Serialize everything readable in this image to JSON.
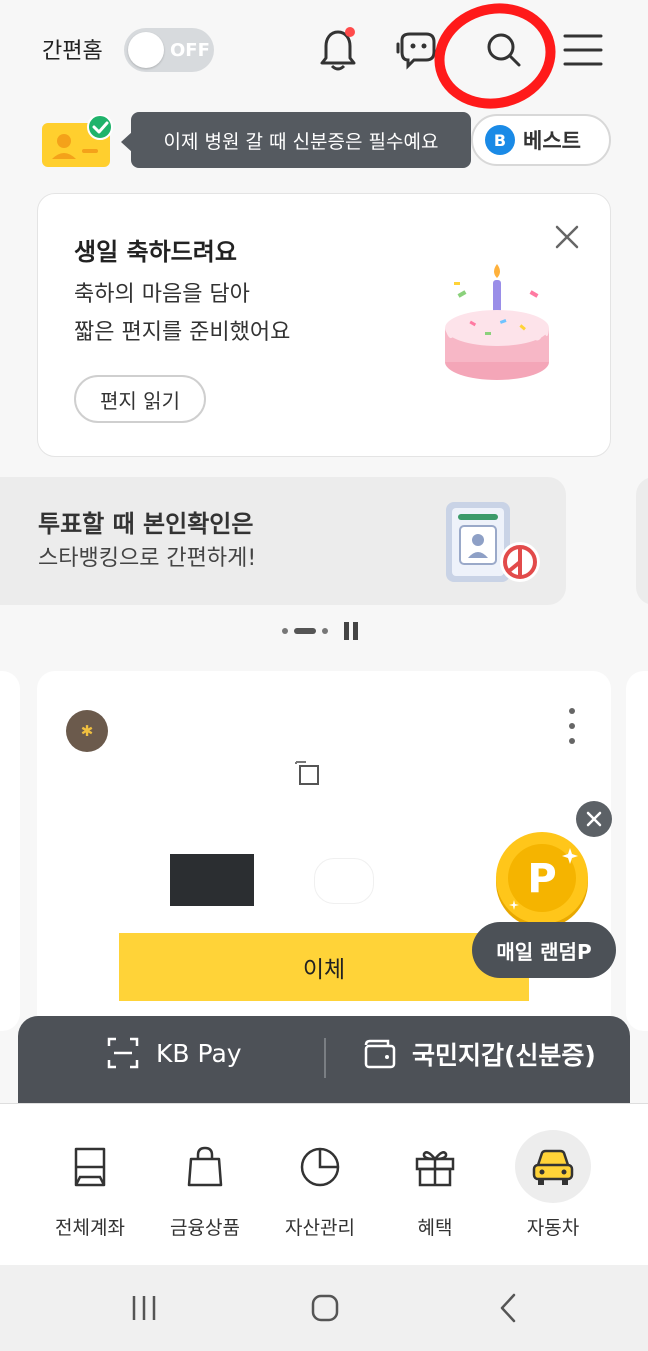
{
  "header": {
    "easy_home_label": "간편홈",
    "toggle_state": "OFF",
    "icons": [
      "bell-icon",
      "chatbot-icon",
      "search-icon",
      "menu-icon"
    ],
    "notification_dot_color": "#ff4b4b"
  },
  "notice": {
    "tooltip_text": "이제 병원 갈 때 신분증은 필수예요",
    "best_badge_letter": "B",
    "best_label": "베스트"
  },
  "birthday_card": {
    "title": "생일 축하드려요",
    "line1": "축하의 마음을 담아",
    "line2": "짧은 편지를 준비했어요",
    "button_label": "편지 읽기"
  },
  "vote_banner": {
    "title": "투표할 때 본인확인은",
    "subtitle": "스타뱅킹으로 간편하게!"
  },
  "account_card": {
    "transfer_label": "이체"
  },
  "points_popup": {
    "coin_letter": "P",
    "label": "매일 랜덤P"
  },
  "pay_bar": {
    "kb_pay_label": "KB Pay",
    "wallet_label": "국민지갑(신분증)"
  },
  "bottom_nav": {
    "items": [
      {
        "label": "전체계좌"
      },
      {
        "label": "금융상품"
      },
      {
        "label": "자산관리"
      },
      {
        "label": "혜택"
      },
      {
        "label": "자동차"
      }
    ]
  },
  "colors": {
    "accent_yellow": "#ffd338",
    "annotation_red": "#ff1a1a",
    "dark_panel": "#4d5157"
  }
}
